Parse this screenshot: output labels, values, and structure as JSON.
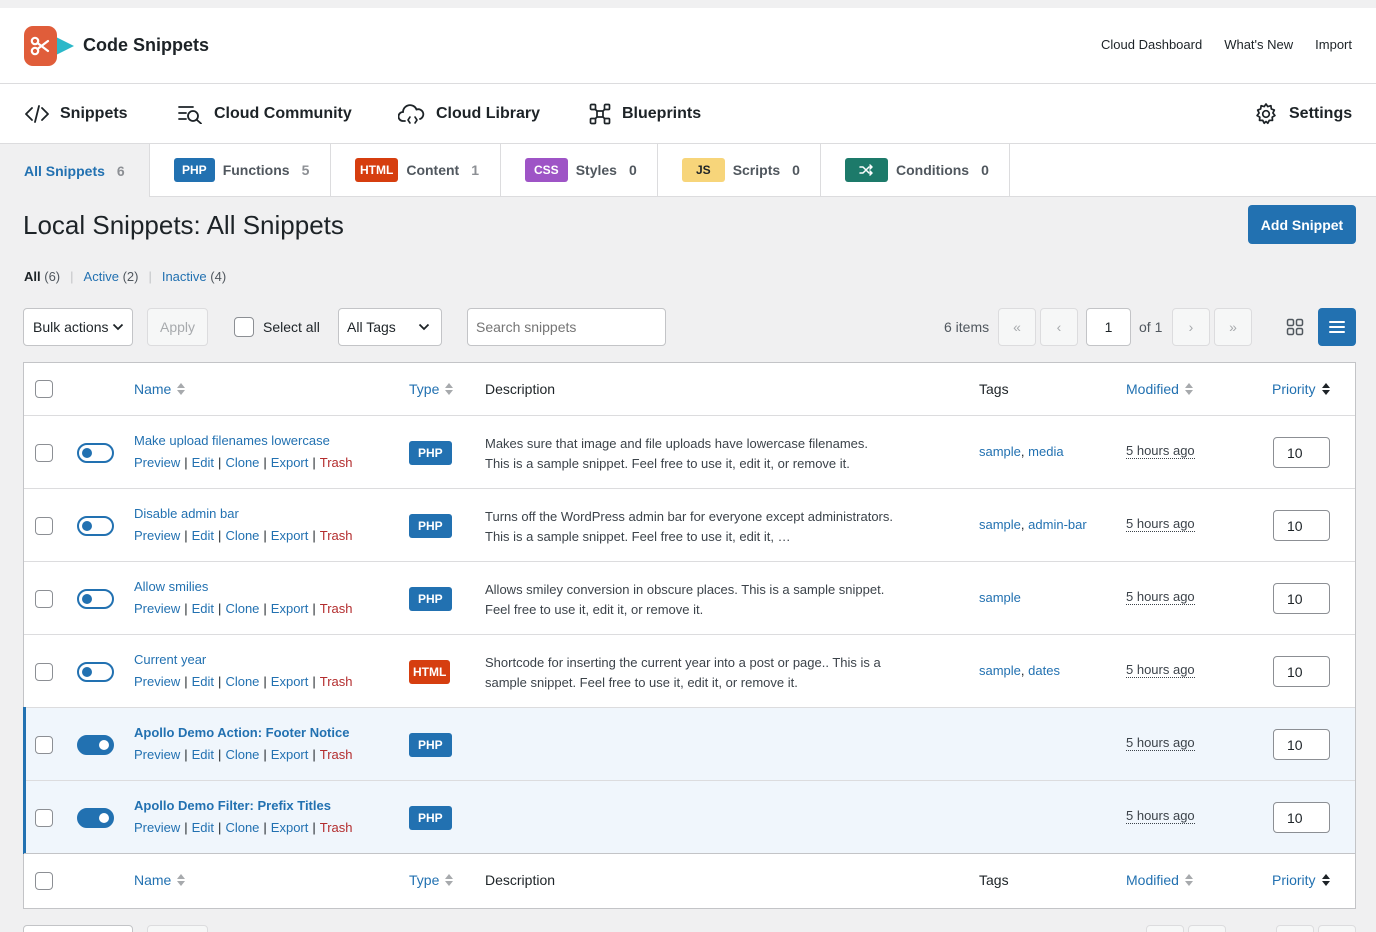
{
  "header": {
    "brand": "Code Snippets",
    "links": [
      "Cloud Dashboard",
      "What's New",
      "Import"
    ]
  },
  "nav": {
    "snippets": "Snippets",
    "cloud_community": "Cloud Community",
    "cloud_library": "Cloud Library",
    "blueprints": "Blueprints",
    "settings": "Settings"
  },
  "type_tabs": [
    {
      "label": "All Snippets",
      "badge": "",
      "count": "6"
    },
    {
      "label": "Functions",
      "badge": "PHP",
      "count": "5"
    },
    {
      "label": "Content",
      "badge": "HTML",
      "count": "1"
    },
    {
      "label": "Styles",
      "badge": "CSS",
      "count": "0"
    },
    {
      "label": "Scripts",
      "badge": "JS",
      "count": "0"
    },
    {
      "label": "Conditions",
      "badge": "",
      "count": "0"
    }
  ],
  "page": {
    "title": "Local Snippets: All Snippets",
    "add_button": "Add Snippet"
  },
  "status_filters": [
    {
      "label": "All",
      "count": "(6)"
    },
    {
      "label": "Active",
      "count": "(2)"
    },
    {
      "label": "Inactive",
      "count": "(4)"
    }
  ],
  "toolbar": {
    "bulk_actions": "Bulk actions",
    "apply": "Apply",
    "select_all": "Select all",
    "tags_filter": "All Tags",
    "search_placeholder": "Search snippets",
    "items": "6 items",
    "first": "«",
    "prev": "‹",
    "page": "1",
    "of": "of 1",
    "next": "›",
    "last": "»"
  },
  "columns": {
    "name": "Name",
    "type": "Type",
    "description": "Description",
    "tags": "Tags",
    "modified": "Modified",
    "priority": "Priority"
  },
  "row_actions": {
    "preview": "Preview",
    "edit": "Edit",
    "clone": "Clone",
    "export": "Export",
    "trash": "Trash"
  },
  "snippets": [
    {
      "name": "Make upload filenames lowercase",
      "active": false,
      "type": "PHP",
      "description": "Makes sure that image and file uploads have lowercase filenames. This is a sample snippet. Feel free to use it, edit it, or remove it.",
      "tags": [
        "sample",
        "media"
      ],
      "modified": "5 hours ago",
      "priority": "10"
    },
    {
      "name": "Disable admin bar",
      "active": false,
      "type": "PHP",
      "description": "Turns off the WordPress admin bar for everyone except administrators. This is a sample snippet. Feel free to use it, edit it, …",
      "tags": [
        "sample",
        "admin-bar"
      ],
      "modified": "5 hours ago",
      "priority": "10"
    },
    {
      "name": "Allow smilies",
      "active": false,
      "type": "PHP",
      "description": "Allows smiley conversion in obscure places. This is a sample snippet. Feel free to use it, edit it, or remove it.",
      "tags": [
        "sample"
      ],
      "modified": "5 hours ago",
      "priority": "10"
    },
    {
      "name": "Current year",
      "active": false,
      "type": "HTML",
      "description": "Shortcode for inserting the current year into a post or page.. This is a sample snippet. Feel free to use it, edit it, or remove it.",
      "tags": [
        "sample",
        "dates"
      ],
      "modified": "5 hours ago",
      "priority": "10"
    },
    {
      "name": "Apollo Demo Action: Footer Notice",
      "active": true,
      "type": "PHP",
      "description": "",
      "tags": [],
      "modified": "5 hours ago",
      "priority": "10"
    },
    {
      "name": "Apollo Demo Filter: Prefix Titles",
      "active": true,
      "type": "PHP",
      "description": "",
      "tags": [],
      "modified": "5 hours ago",
      "priority": "10"
    }
  ],
  "colors": {
    "accent": "#2271b1",
    "php": "#2271b1",
    "html": "#d63e0f",
    "css": "#9e54c6",
    "js": "#f7d57a",
    "conditions": "#1d7a6a",
    "trash": "#b32d2e"
  }
}
